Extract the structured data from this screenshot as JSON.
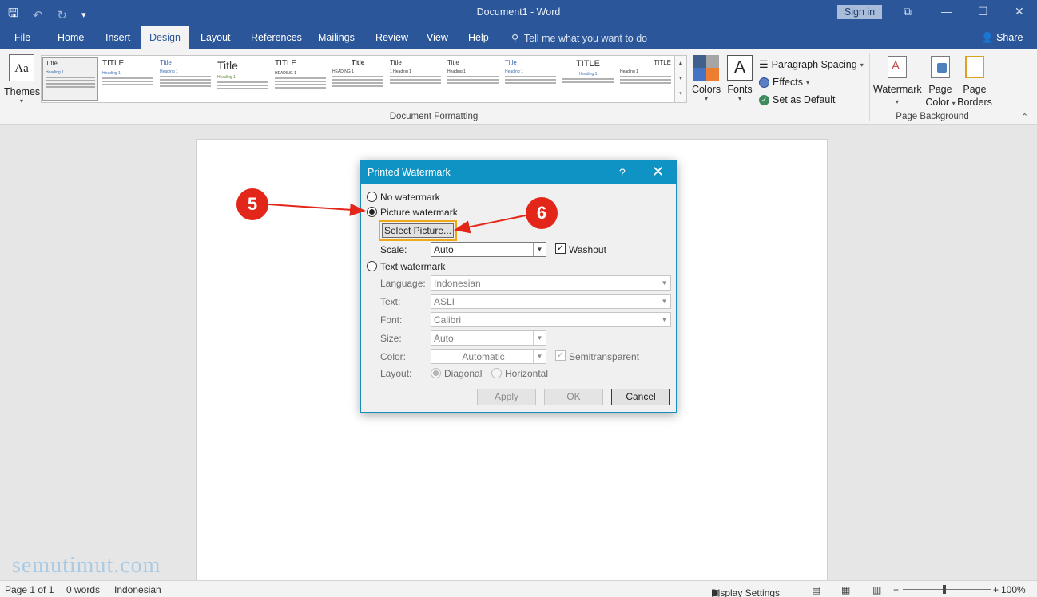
{
  "titlebar": {
    "title": "Document1  -  Word",
    "sign_in": "Sign in",
    "qat": {
      "save_icon": "save-icon",
      "undo_icon": "undo-icon",
      "redo_icon": "redo-icon",
      "customize_icon": "customize-icon"
    },
    "window_controls": {
      "ribbon_display": "⧉",
      "minimize": "—",
      "maximize": "☐",
      "close": "✕"
    }
  },
  "tabs": [
    "File",
    "Home",
    "Insert",
    "Design",
    "Layout",
    "References",
    "Mailings",
    "Review",
    "View",
    "Help"
  ],
  "active_tab": "Design",
  "tell_me": "Tell me what you want to do",
  "share": "Share",
  "ribbon": {
    "themes_label": "Themes",
    "themes_icon_text": "Aa",
    "gallery_styles": [
      {
        "title": "Title",
        "heading": "Heading 1"
      },
      {
        "title": "TITLE",
        "heading": "Heading 1"
      },
      {
        "title": "Title",
        "heading": "Heading 1"
      },
      {
        "title": "Title",
        "heading": "Heading 1"
      },
      {
        "title": "TITLE",
        "heading": "HEADING 1"
      },
      {
        "title": "Title",
        "heading": "HEADING 1"
      },
      {
        "title": "Title",
        "heading": "1  Heading 1"
      },
      {
        "title": "Title",
        "heading": "Heading 1"
      },
      {
        "title": "Title",
        "heading": "Heading 1"
      },
      {
        "title": "TITLE",
        "heading": "Heading 1"
      },
      {
        "title": "TITLE",
        "heading": "Heading 1"
      }
    ],
    "document_formatting_label": "Document Formatting",
    "colors_label": "Colors",
    "fonts_label": "Fonts",
    "fonts_icon_text": "A",
    "paragraph_spacing": "Paragraph Spacing",
    "effects": "Effects",
    "set_as_default": "Set as Default",
    "watermark": "Watermark",
    "page_color_1": "Page",
    "page_color_2": "Color",
    "page_borders_1": "Page",
    "page_borders_2": "Borders",
    "page_background_label": "Page Background",
    "colors_swatches": [
      "#3f5f8c",
      "#a5a5a5",
      "#4472c4",
      "#ed7d31"
    ]
  },
  "dialog": {
    "title": "Printed Watermark",
    "help": "?",
    "close": "✕",
    "no_watermark": "No watermark",
    "picture_watermark": "Picture watermark",
    "select_picture": "Select Picture...",
    "scale_label": "Scale:",
    "scale_value": "Auto",
    "washout": "Washout",
    "text_watermark": "Text watermark",
    "language_label": "Language:",
    "language_value": "Indonesian",
    "text_label": "Text:",
    "text_value": "ASLI",
    "font_label": "Font:",
    "font_value": "Calibri",
    "size_label": "Size:",
    "size_value": "Auto",
    "color_label": "Color:",
    "color_value": "Automatic",
    "semitransparent": "Semitransparent",
    "layout_label": "Layout:",
    "diagonal": "Diagonal",
    "horizontal": "Horizontal",
    "apply": "Apply",
    "ok": "OK",
    "cancel": "Cancel"
  },
  "annotations": {
    "step5": "5",
    "step6": "6",
    "arrow_color": "#e3261a"
  },
  "site_watermark": "semutimut.com",
  "status": {
    "page": "Page 1 of 1",
    "words": "0 words",
    "language": "Indonesian",
    "display_settings": "Display Settings",
    "zoom": "100%"
  }
}
